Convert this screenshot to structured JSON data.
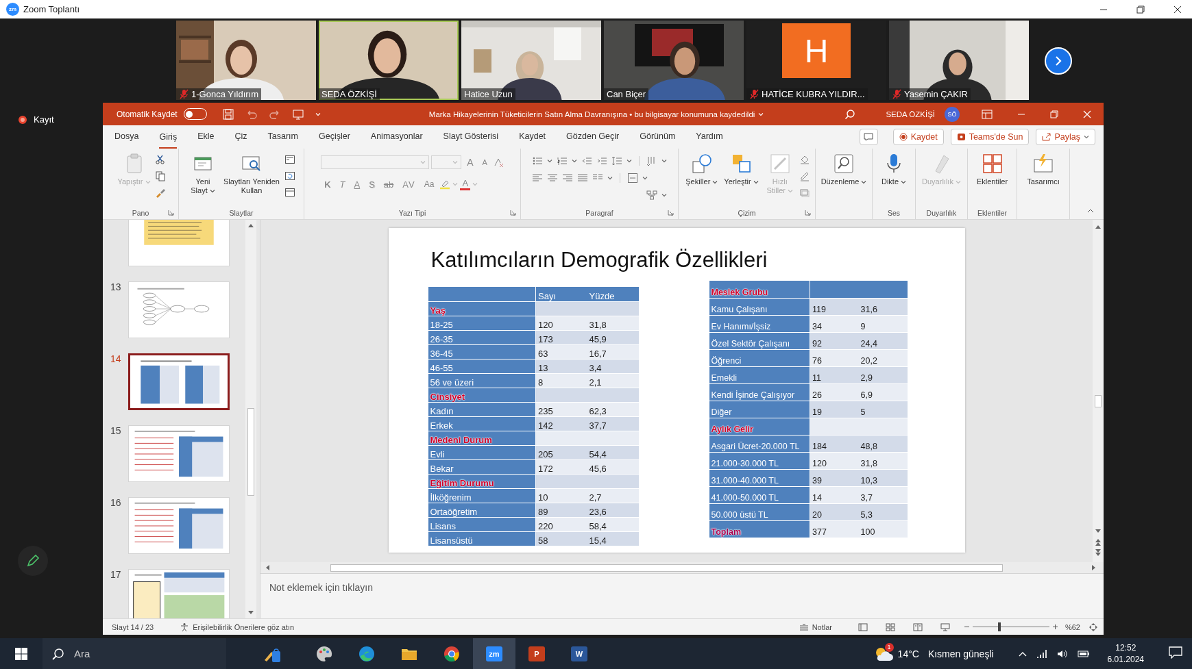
{
  "zoom_window": {
    "icon_text": "zm",
    "title": "Zoom Toplantı"
  },
  "participants": [
    {
      "name": "1-Gonca Yıldırım",
      "kind": "video",
      "muted": true,
      "speaking": false
    },
    {
      "name": "SEDA ÖZKİŞİ",
      "kind": "video",
      "muted": false,
      "speaking": true
    },
    {
      "name": "Hatice Uzun",
      "kind": "video",
      "muted": false,
      "speaking": false
    },
    {
      "name": "Can Biçer",
      "kind": "video",
      "muted": false,
      "speaking": false
    },
    {
      "name": "HATİCE KUBRA YILDIR...",
      "kind": "avatar",
      "initial": "H",
      "muted": true,
      "speaking": false
    },
    {
      "name": "Yasemin ÇAKIR",
      "kind": "video",
      "muted": true,
      "speaking": false
    }
  ],
  "recording": {
    "label": "Kayıt"
  },
  "powerpoint": {
    "title_bar": {
      "autosave_label": "Otomatik Kaydet",
      "autosave_on": false,
      "document_title": "Marka Hikayelerinin Tüketicilerin Satın Alma Davranışına • bu bilgisayar konumuna kaydedildi",
      "user_name": "SEDA ÖZKİŞİ",
      "user_initials": "SÖ"
    },
    "menu_tabs": [
      {
        "label": "Dosya",
        "selected": false
      },
      {
        "label": "Giriş",
        "selected": true
      },
      {
        "label": "Ekle",
        "selected": false
      },
      {
        "label": "Çiz",
        "selected": false
      },
      {
        "label": "Tasarım",
        "selected": false
      },
      {
        "label": "Geçişler",
        "selected": false
      },
      {
        "label": "Animasyonlar",
        "selected": false
      },
      {
        "label": "Slayt Gösterisi",
        "selected": false
      },
      {
        "label": "Kaydet",
        "selected": false
      },
      {
        "label": "Gözden Geçir",
        "selected": false
      },
      {
        "label": "Görünüm",
        "selected": false
      },
      {
        "label": "Yardım",
        "selected": false
      }
    ],
    "header_buttons": [
      {
        "kind": "record",
        "label": "Kaydet"
      },
      {
        "kind": "teams",
        "label": "Teams'de Sun"
      },
      {
        "kind": "share",
        "label": "Paylaş"
      }
    ],
    "ribbon_groups": [
      {
        "kind": "clipboard",
        "label": "Pano",
        "buttons": [
          {
            "kind": "paste",
            "label": "Yapıştır",
            "disabled": true,
            "menu": true
          }
        ]
      },
      {
        "kind": "slides",
        "label": "Slaytlar",
        "buttons": [
          {
            "kind": "new-slide",
            "label": "Yeni Slayt",
            "disabled": false,
            "menu": true
          },
          {
            "kind": "reuse",
            "label": "Slaytları Yeniden Kullan",
            "disabled": false,
            "menu": false
          }
        ]
      },
      {
        "kind": "font",
        "label": "Yazı Tipi",
        "size_buttons": [
          "A",
          "A"
        ],
        "format_buttons": [
          "K",
          "T",
          "A",
          "S",
          "ab",
          "AV",
          "Aa"
        ],
        "color_button": "A"
      },
      {
        "kind": "paragraph",
        "label": "Paragraf"
      },
      {
        "kind": "drawing",
        "label": "Çizim",
        "buttons": [
          {
            "kind": "shapes",
            "label": "Şekiller",
            "disabled": false,
            "menu": true
          },
          {
            "kind": "arrange",
            "label": "Yerleştir",
            "disabled": false,
            "menu": true
          },
          {
            "kind": "quick-styles",
            "label": "Hızlı Stiller",
            "disabled": true,
            "menu": true
          }
        ]
      },
      {
        "kind": "plain",
        "buttons": [
          {
            "kind": "find",
            "label": "Düzenleme",
            "disabled": false,
            "menu": true
          }
        ]
      },
      {
        "kind": "plain",
        "label": "Ses",
        "buttons": [
          {
            "kind": "mic",
            "label": "Dikte",
            "disabled": false,
            "menu": true
          }
        ]
      },
      {
        "kind": "plain",
        "label": "Duyarlılık",
        "buttons": [
          {
            "kind": "sensitivity",
            "label": "Duyarlılık",
            "disabled": true,
            "menu": true
          }
        ]
      },
      {
        "kind": "plain",
        "label": "Eklentiler",
        "buttons": [
          {
            "kind": "addins",
            "label": "Eklentiler",
            "disabled": false,
            "menu": false
          }
        ]
      },
      {
        "kind": "plain",
        "buttons": [
          {
            "kind": "designer",
            "label": "Tasarımcı",
            "disabled": false,
            "menu": false
          }
        ]
      }
    ],
    "thumbnails": [
      {
        "kind": "list",
        "selected": false
      },
      {
        "number": "13",
        "kind": "diagram",
        "selected": false
      },
      {
        "number": "14",
        "kind": "tables",
        "selected": true
      },
      {
        "number": "15",
        "kind": "text-table",
        "selected": false
      },
      {
        "number": "16",
        "kind": "text-table",
        "selected": false
      },
      {
        "number": "17",
        "kind": "chart-table",
        "selected": false
      }
    ],
    "slide": {
      "title": "Katılımcıların Demografik Özellikleri",
      "tables": [
        {
          "rows": [
            {
              "kind": "header",
              "values": [
                "Sayı",
                "Yüzde"
              ]
            },
            {
              "kind": "section",
              "label": "Yaş"
            },
            {
              "kind": "data",
              "label": "18-25",
              "values": [
                "120",
                "31,8"
              ]
            },
            {
              "kind": "data",
              "label": "26-35",
              "values": [
                "173",
                "45,9"
              ]
            },
            {
              "kind": "data",
              "label": "36-45",
              "values": [
                "63",
                "16,7"
              ]
            },
            {
              "kind": "data",
              "label": "46-55",
              "values": [
                "13",
                "3,4"
              ]
            },
            {
              "kind": "data",
              "label": "56 ve üzeri",
              "values": [
                "8",
                "2,1"
              ]
            },
            {
              "kind": "section",
              "label": "Cinsiyet"
            },
            {
              "kind": "data",
              "label": "Kadın",
              "values": [
                "235",
                "62,3"
              ]
            },
            {
              "kind": "data",
              "label": "Erkek",
              "values": [
                "142",
                "37,7"
              ]
            },
            {
              "kind": "section",
              "label": "Medeni Durum"
            },
            {
              "kind": "data",
              "label": "Evli",
              "values": [
                "205",
                "54,4"
              ]
            },
            {
              "kind": "data",
              "label": "Bekar",
              "values": [
                "172",
                "45,6"
              ]
            },
            {
              "kind": "section",
              "label": "Eğitim Durumu"
            },
            {
              "kind": "data",
              "label": "İlköğrenim",
              "values": [
                "10",
                "2,7"
              ]
            },
            {
              "kind": "data",
              "label": "Ortaöğretim",
              "values": [
                "89",
                "23,6"
              ]
            },
            {
              "kind": "data",
              "label": "Lisans",
              "values": [
                "220",
                "58,4"
              ]
            },
            {
              "kind": "data",
              "label": "Lisansüstü",
              "values": [
                "58",
                "15,4"
              ]
            }
          ]
        },
        {
          "rows": [
            {
              "kind": "header",
              "label": "Meslek Grubu"
            },
            {
              "kind": "data",
              "label": "Kamu Çalışanı",
              "values": [
                "119",
                "31,6"
              ]
            },
            {
              "kind": "data",
              "label": "Ev Hanımı/İşsiz",
              "values": [
                "34",
                "9"
              ]
            },
            {
              "kind": "data",
              "label": "Özel Sektör Çalışanı",
              "values": [
                "92",
                "24,4"
              ]
            },
            {
              "kind": "data",
              "label": "Öğrenci",
              "values": [
                "76",
                "20,2"
              ]
            },
            {
              "kind": "data",
              "label": "Emekli",
              "values": [
                "11",
                "2,9"
              ]
            },
            {
              "kind": "data",
              "label": "Kendi İşinde Çalışıyor",
              "values": [
                "26",
                "6,9"
              ]
            },
            {
              "kind": "data",
              "label": "Diğer",
              "values": [
                "19",
                "5"
              ]
            },
            {
              "kind": "section",
              "label": "Aylık Gelir"
            },
            {
              "kind": "data",
              "label": "Asgari Ücret-20.000 TL",
              "values": [
                "184",
                "48,8"
              ]
            },
            {
              "kind": "data",
              "label": "21.000-30.000 TL",
              "values": [
                "120",
                "31,8"
              ]
            },
            {
              "kind": "data",
              "label": "31.000-40.000 TL",
              "values": [
                "39",
                "10,3"
              ]
            },
            {
              "kind": "data",
              "label": "41.000-50.000 TL",
              "values": [
                "14",
                "3,7"
              ]
            },
            {
              "kind": "data",
              "label": "50.000 üstü TL",
              "values": [
                "20",
                "5,3"
              ]
            },
            {
              "kind": "total",
              "label": "Toplam",
              "values": [
                "377",
                "100"
              ]
            }
          ]
        }
      ]
    },
    "notes": {
      "placeholder": "Not eklemek için tıklayın"
    },
    "status_bar": {
      "slide_counter": "Slayt 14 / 23",
      "accessibility": "Erişilebilirlik Önerilere göz atın",
      "notes_button": "Notlar",
      "zoom_slider": {
        "level": 0.35
      },
      "zoom_percent": "%62"
    }
  },
  "taskbar": {
    "search": {
      "placeholder": "Ara"
    },
    "apps": [
      {
        "kind": "widget",
        "selected": false
      },
      {
        "kind": "paint",
        "selected": false
      },
      {
        "kind": "edge",
        "selected": false
      },
      {
        "kind": "explorer",
        "selected": false
      },
      {
        "kind": "chrome",
        "selected": false
      },
      {
        "kind": "zoom",
        "glyph": "zm",
        "selected": true
      },
      {
        "kind": "powerpoint",
        "glyph": "P",
        "selected": false
      },
      {
        "kind": "word",
        "glyph": "W",
        "selected": false
      }
    ],
    "weather": {
      "badge": "1",
      "temperature": "14°C",
      "condition": "Kısmen güneşli"
    },
    "time": "12:52",
    "date": "6.01.2024"
  }
}
